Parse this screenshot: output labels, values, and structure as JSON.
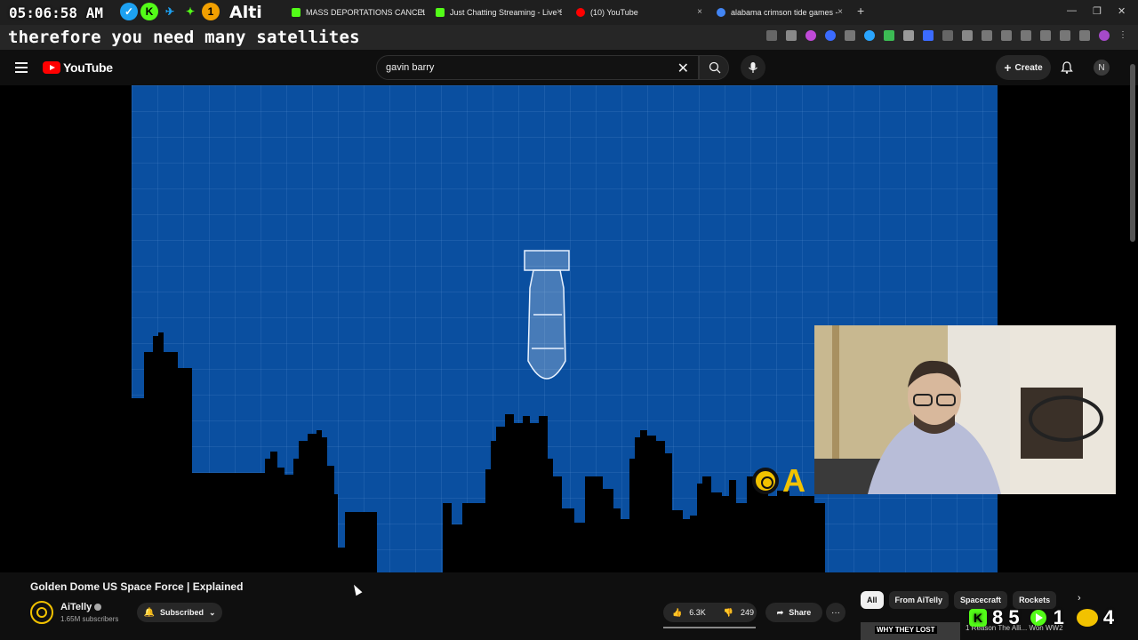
{
  "browser": {
    "tabs": [
      {
        "label": "MASS DEPORTATIONS CANCEL",
        "favicon_color": "#53fc18"
      },
      {
        "label": "Just Chatting Streaming - Live S",
        "favicon_color": "#53fc18"
      },
      {
        "label": "(10) YouTube",
        "favicon_color": "#ff0000"
      },
      {
        "label": "alabama crimson tide games - ",
        "favicon_color": "#4285f4"
      }
    ],
    "new_tab_label": "+",
    "close_glyph": "×"
  },
  "overlay": {
    "clock": "05:06:58 AM",
    "name": "Alti",
    "badge": "1",
    "caption": "therefore you need many satellites"
  },
  "youtube": {
    "logo_text": "YouTube",
    "search_value": "gavin barry",
    "create_label": "Create",
    "account_initial": "N"
  },
  "video": {
    "title": "Golden Dome US Space Force | Explained",
    "watermark_letter": "A",
    "channel": {
      "name": "AiTelly",
      "subscribers": "1.65M subscribers",
      "subscribe_state": "Subscribed"
    },
    "likes": "6.3K",
    "dislikes": "249",
    "share_label": "Share",
    "more_label": "···"
  },
  "sidebar": {
    "chips": [
      {
        "label": "All",
        "active": true
      },
      {
        "label": "From AiTelly",
        "active": false
      },
      {
        "label": "Spacecraft",
        "active": false
      },
      {
        "label": "Rockets",
        "active": false
      }
    ],
    "reco_thumb_text": "WHY THEY LOST",
    "reco_title": "1 Reason The Alli... Won WW2"
  },
  "stream_stats": {
    "kick_count": "8 5",
    "youtube_count": "1",
    "rumble_count": "4"
  },
  "colors": {
    "video_bg": "#0a4fa0",
    "accent_yellow": "#f2c200",
    "yt_red": "#ff0000",
    "kick_green": "#53fc18"
  },
  "icons": [
    "search-icon",
    "mic-icon",
    "bell-icon",
    "menu-icon",
    "like-icon",
    "dislike-icon",
    "share-icon",
    "close-icon"
  ]
}
